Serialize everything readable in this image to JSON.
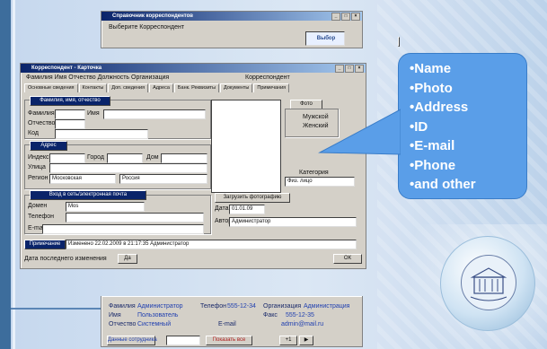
{
  "slide": {
    "callout_items": [
      "•Name",
      "•Photo",
      "•Address",
      "•ID",
      "•E-mail",
      "•Phone",
      "•and other"
    ],
    "accent_color": "#5a9ee8"
  },
  "back_window": {
    "title": "Справочник корреспондентов",
    "subtitle": "Выберите Корреспондент",
    "badge": "Выбор"
  },
  "main_window": {
    "title": "Корреспондент - Карточка",
    "header_line": "Фамилия Имя Отчество Должность Организация",
    "header_right": "Корреспондент",
    "tabs": [
      "Основные сведения",
      "Контакты",
      "Доп. сведения",
      "Адреса",
      "Банк. Реквизиты",
      "Документы",
      "Примечания"
    ],
    "group_name": "Фамилия, имя, отчество",
    "label_surname": "Фамилия",
    "label_name": "Имя",
    "label_patronymic": "Отчество",
    "label_id": "Код",
    "group_address": "Адрес",
    "label_index": "Индекс",
    "label_city": "Город",
    "label_house": "Дом",
    "label_street": "Улица",
    "label_region": "Регион",
    "region_value": "Московская",
    "country_value": "Россия",
    "group_login": "Вход в сеть/электронная почта",
    "label_domain": "Домен",
    "domain_value": "Mos",
    "label_phone": "Телефон",
    "label_email": "E-mail",
    "photo_button": "Фото",
    "radio_male": "Мужской",
    "radio_female": "Женский",
    "label_category": "Категория",
    "category_value": "Физ. лицо",
    "load_photo_button": "Загрузить фотографию",
    "label_date": "Дата",
    "date_value": "01.01.09",
    "label_author": "Автор",
    "author_value": "Администратор",
    "note_button": "Примечание",
    "note_value": "Изменено 22.02.2009 в 21:17:35 Администратор",
    "bottom_label": "Дата последнего изменения",
    "bottom_value": "Да",
    "ok_button": "ОК"
  },
  "status_panel": {
    "row1": [
      "Фамилия",
      "Администратор",
      "Телефон",
      "555-12-34",
      "Организация",
      "Администрация"
    ],
    "row2": [
      "Имя",
      "Пользователь",
      "Факс",
      "555-12-35"
    ],
    "row3": [
      "Отчество",
      "Системный",
      "E-mail",
      "admin@mail.ru"
    ],
    "button_left": "Данные сотрудника",
    "button_mid": "Показать все",
    "nav_prev": "+1",
    "nav_next": "▶"
  }
}
